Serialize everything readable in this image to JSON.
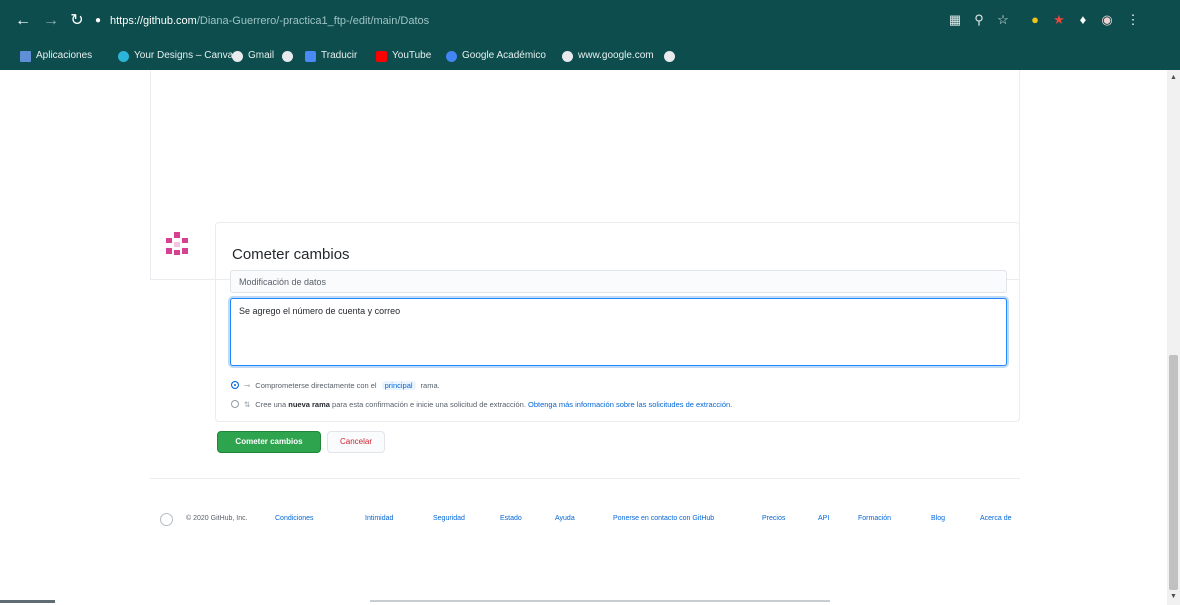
{
  "browser": {
    "url_host": "https://github.com",
    "url_path": "/Diana-Guerrero/-practica1_ftp-/edit/main/Datos",
    "bookmarks": [
      {
        "label": "Aplicaciones",
        "icon": "apps-grid-icon",
        "color": "#5f8fd6"
      },
      {
        "label": "Your Designs – Canva",
        "icon": "canva-icon",
        "color": "#2bb5d8"
      },
      {
        "label": "Gmail",
        "icon": "globe-icon",
        "color": "#e8eaed"
      },
      {
        "label": "",
        "icon": "globe-icon",
        "color": "#e8eaed"
      },
      {
        "label": "Traducir",
        "icon": "translate-icon",
        "color": "#4a8af4"
      },
      {
        "label": "YouTube",
        "icon": "youtube-icon",
        "color": "#ff0000"
      },
      {
        "label": "Google Académico",
        "icon": "scholar-icon",
        "color": "#4285f4"
      },
      {
        "label": "www.google.com",
        "icon": "globe-icon",
        "color": "#e8eaed"
      },
      {
        "label": "",
        "icon": "globe-icon",
        "color": "#e8eaed"
      }
    ]
  },
  "commit": {
    "title": "Cometer cambios",
    "summary_value": "Modificación de datos",
    "description_value": "Se agrego el número de cuenta y correo",
    "option_direct_prefix": "Comprometerse directamente con el",
    "option_direct_branch": "principal",
    "option_direct_suffix": "rama.",
    "option_new_prefix": "Cree una",
    "option_new_bold": "nueva rama",
    "option_new_middle": "para esta confirmación e inicie una solicitud de extracción.",
    "option_new_link": "Obtenga más información sobre las solicitudes de extracción.",
    "commit_button": "Cometer cambios",
    "cancel_button": "Cancelar"
  },
  "footer": {
    "copyright": "© 2020 GitHub, Inc.",
    "links": [
      "Condiciones",
      "Intimidad",
      "Seguridad",
      "Estado",
      "Ayuda",
      "Ponerse en contacto con GitHub",
      "Precios",
      "API",
      "Formación",
      "Blog",
      "Acerca de"
    ]
  },
  "colors": {
    "chrome": "#0d4d4d",
    "primary_button": "#2ea44f",
    "link": "#0366d6",
    "danger": "#cb2431"
  }
}
